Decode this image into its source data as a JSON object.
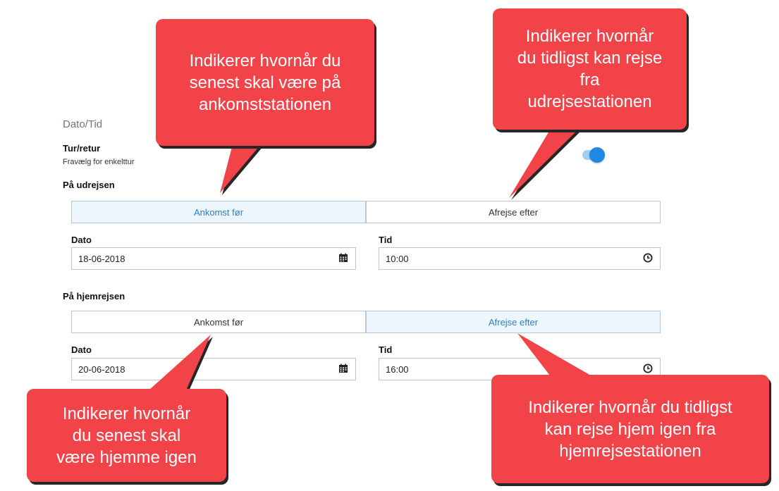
{
  "form": {
    "section_title": "Dato/Tid",
    "roundtrip": {
      "label": "Tur/retur",
      "hint": "Fravælg for enkelttur",
      "enabled": true
    },
    "outbound": {
      "heading": "På udrejsen",
      "options": [
        "Ankomst før",
        "Afrejse efter"
      ],
      "selected": "Ankomst før",
      "date_label": "Dato",
      "date_value": "18-06-2018",
      "time_label": "Tid",
      "time_value": "10:00"
    },
    "return": {
      "heading": "På hjemrejsen",
      "options": [
        "Ankomst før",
        "Afrejse efter"
      ],
      "selected": "Afrejse efter",
      "date_label": "Dato",
      "date_value": "20-06-2018",
      "time_label": "Tid",
      "time_value": "16:00"
    }
  },
  "callouts": {
    "outbound_arrival": "Indikerer hvornår du senest skal være på ankomststationen",
    "outbound_departure": "Indikerer hvornår du tidligst kan rejse fra udrejsestationen",
    "return_arrival": "Indikerer hvornår du senest skal være hjemme igen",
    "return_departure": "Indikerer hvornår du tidligst kan rejse hjem igen fra hjemrejsestationen"
  },
  "icons": {
    "date": "calendar-icon",
    "time": "clock-icon"
  },
  "colors": {
    "callout": "#f14348",
    "accent": "#1e88e5",
    "active_segment": "#edf5fd",
    "active_text": "#2f7fc4"
  }
}
